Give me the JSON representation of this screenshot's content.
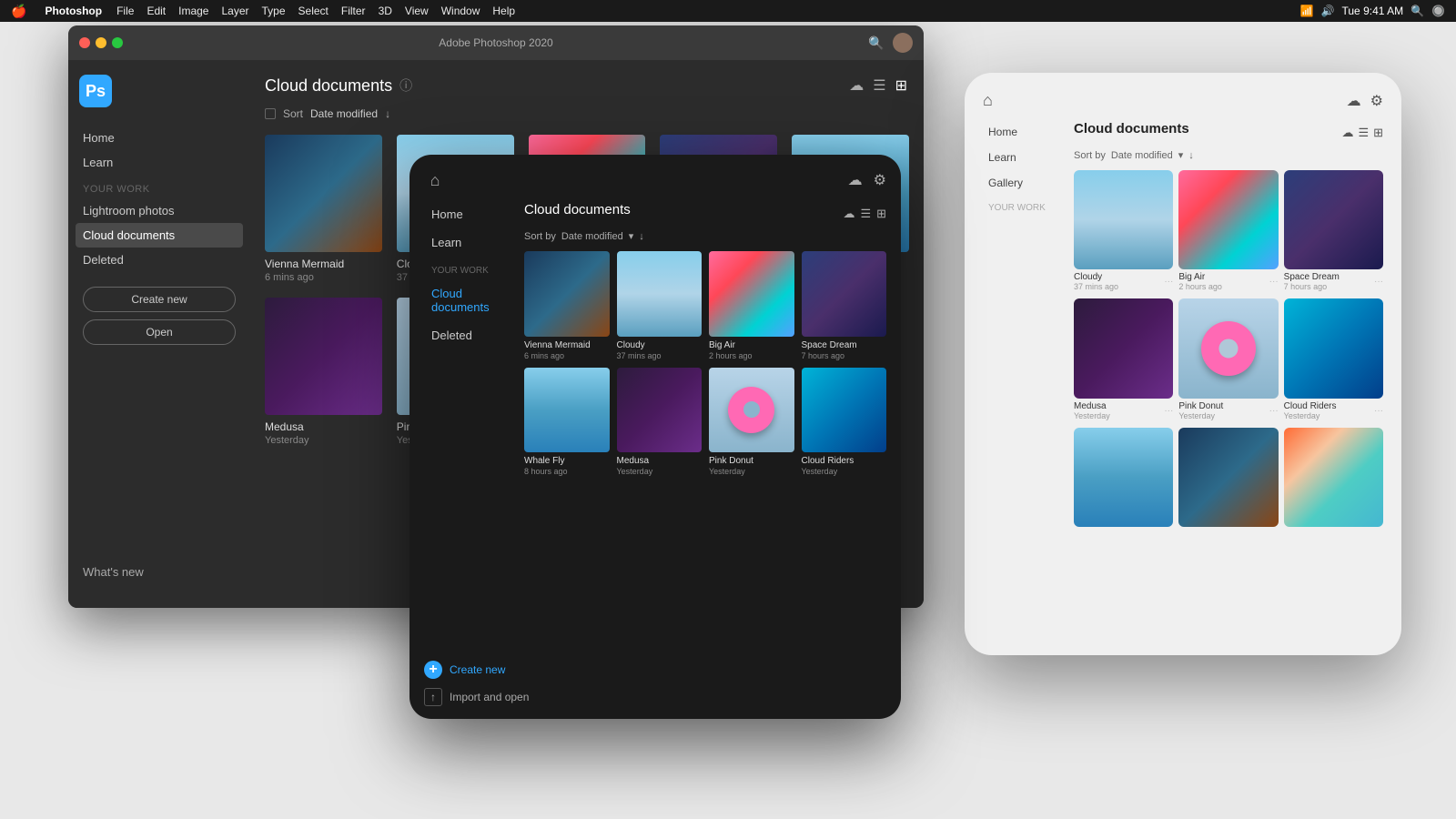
{
  "menubar": {
    "apple": "🍎",
    "app": "Photoshop",
    "items": [
      "File",
      "Edit",
      "Image",
      "Layer",
      "Type",
      "Select",
      "Filter",
      "3D",
      "View",
      "Window",
      "Help"
    ],
    "title": "Adobe Photoshop 2020",
    "time": "Tue 9:41 AM"
  },
  "ps_window": {
    "title": "Adobe Photoshop 2020",
    "sidebar": {
      "nav": [
        {
          "label": "Home",
          "active": false
        },
        {
          "label": "Learn",
          "active": false
        }
      ],
      "section": "YOUR WORK",
      "work_items": [
        {
          "label": "Lightroom photos",
          "active": false
        },
        {
          "label": "Cloud documents",
          "active": true
        },
        {
          "label": "Deleted",
          "active": false
        }
      ],
      "btn_create": "Create new",
      "btn_open": "Open",
      "whats_new": "What's new"
    },
    "main": {
      "title": "Cloud documents",
      "sort_label": "Sort",
      "sort_by": "Date modified",
      "view_modes": [
        "cloud",
        "list",
        "grid"
      ],
      "documents": [
        {
          "name": "Vienna Mermaid",
          "time": "6 mins ago",
          "thumb": "vienna"
        },
        {
          "name": "Cloudy",
          "time": "37 mins ago",
          "thumb": "cloudy"
        },
        {
          "name": "Big Air",
          "time": "2 hours ago",
          "thumb": "bigair"
        },
        {
          "name": "Space Dream",
          "time": "7 hours ago",
          "thumb": "spacedream"
        },
        {
          "name": "Whale Fly",
          "time": "8 hours ago",
          "thumb": "whalefly"
        },
        {
          "name": "Medusa",
          "time": "Yesterday",
          "thumb": "medusa"
        },
        {
          "name": "Pink Donut",
          "time": "Yesterday",
          "thumb": "pinkdonut"
        },
        {
          "name": "",
          "time": "",
          "thumb": "colorful"
        },
        {
          "name": "",
          "time": "",
          "thumb": "teal"
        }
      ]
    }
  },
  "ipad_dark": {
    "nav": [
      "Home",
      "Learn"
    ],
    "section": "YOUR WORK",
    "work_items": [
      "Cloud documents",
      "Deleted"
    ],
    "main_title": "Cloud documents",
    "sort_by": "Date modified",
    "documents": [
      {
        "name": "Vienna Mermaid",
        "time": "6 mins ago",
        "thumb": "vienna"
      },
      {
        "name": "Cloudy",
        "time": "37 mins ago",
        "thumb": "cloudy"
      },
      {
        "name": "Big Air",
        "time": "2 hours ago",
        "thumb": "bigair"
      },
      {
        "name": "Space Dream",
        "time": "7 hours ago",
        "thumb": "spacedream"
      },
      {
        "name": "Whale Fly",
        "time": "8 hours ago",
        "thumb": "whalefly"
      },
      {
        "name": "Medusa",
        "time": "Yesterday",
        "thumb": "medusa"
      },
      {
        "name": "Pink Donut",
        "time": "Yesterday",
        "thumb": "pinkdonut"
      },
      {
        "name": "Cloud Riders",
        "time": "Yesterday",
        "thumb": "teal"
      }
    ],
    "actions": [
      {
        "label": "Create new",
        "icon": "+"
      },
      {
        "label": "Import and open",
        "icon": "↑"
      }
    ]
  },
  "ipad_light": {
    "nav": [
      "Home",
      "Learn",
      "Gallery"
    ],
    "section": "YOUR WORK",
    "main_title": "Cloud documents",
    "sort_by": "Date modified",
    "documents": [
      {
        "name": "Cloudy",
        "time": "37 mins ago",
        "thumb": "cloudy"
      },
      {
        "name": "Big Air",
        "time": "2 hours ago",
        "thumb": "bigair"
      },
      {
        "name": "Space Dream",
        "time": "7 hours ago",
        "thumb": "spacedream"
      },
      {
        "name": "Medusa",
        "time": "Yesterday",
        "thumb": "medusa"
      },
      {
        "name": "Pink Donut",
        "time": "Yesterday",
        "thumb": "pinkdonut"
      },
      {
        "name": "Cloud Riders",
        "time": "Yesterday",
        "thumb": "teal"
      }
    ]
  }
}
